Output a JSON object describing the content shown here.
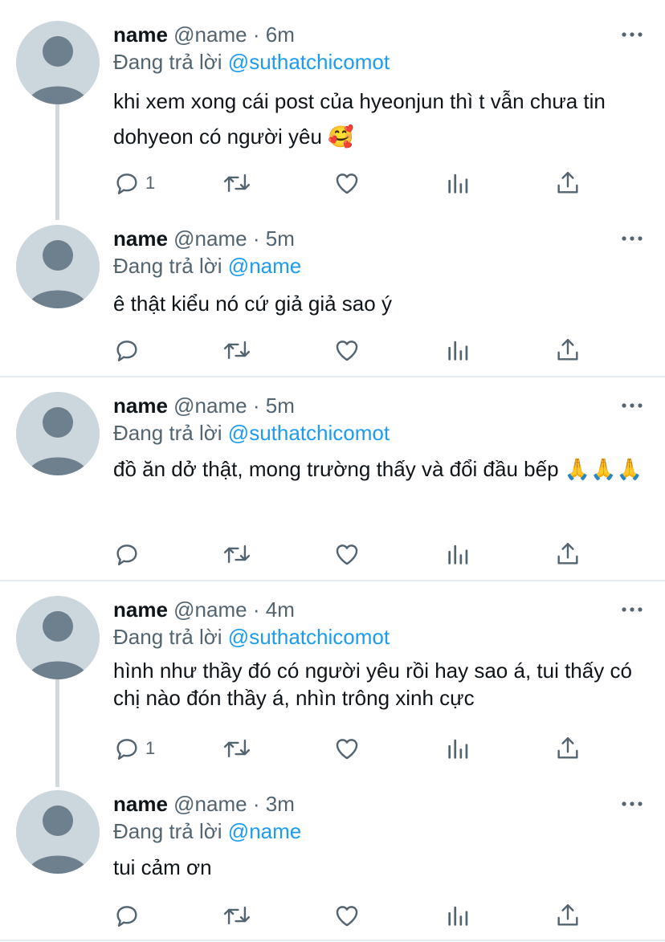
{
  "colors": {
    "accent": "#1d9bf0",
    "secondary_text": "#536471",
    "avatar_bg": "#ccd6dd",
    "avatar_fg": "#6e7f8d"
  },
  "tweets": [
    {
      "name": "name",
      "handle": "@name",
      "dot": "·",
      "time": "6m",
      "replying_prefix": "Đang trả lời",
      "mention": "@suthatchicomot",
      "text": "khi xem xong cái post của hyeonjun thì t vẫn chưa tin dohyeon có người yêu 🥰",
      "reply_count": "1"
    },
    {
      "name": "name",
      "handle": "@name",
      "dot": "·",
      "time": "5m",
      "replying_prefix": "Đang trả lời",
      "mention": "@name",
      "text": "ê thật kiểu nó cứ giả giả sao ý",
      "reply_count": ""
    },
    {
      "name": "name",
      "handle": "@name",
      "dot": "·",
      "time": "5m",
      "replying_prefix": "Đang trả lời",
      "mention": "@suthatchicomot",
      "text": "đồ ăn dở thật, mong trường thấy và đổi đầu bếp 🙏🙏🙏",
      "reply_count": ""
    },
    {
      "name": "name",
      "handle": "@name",
      "dot": "·",
      "time": "4m",
      "replying_prefix": "Đang trả lời",
      "mention": "@suthatchicomot",
      "text": "hình như thầy đó có người yêu rồi hay sao á, tui thấy có chị nào đón thầy á, nhìn trông xinh cực",
      "reply_count": "1"
    },
    {
      "name": "name",
      "handle": "@name",
      "dot": "·",
      "time": "3m",
      "replying_prefix": "Đang trả lời",
      "mention": "@name",
      "text": "tui cảm ơn",
      "reply_count": ""
    }
  ]
}
